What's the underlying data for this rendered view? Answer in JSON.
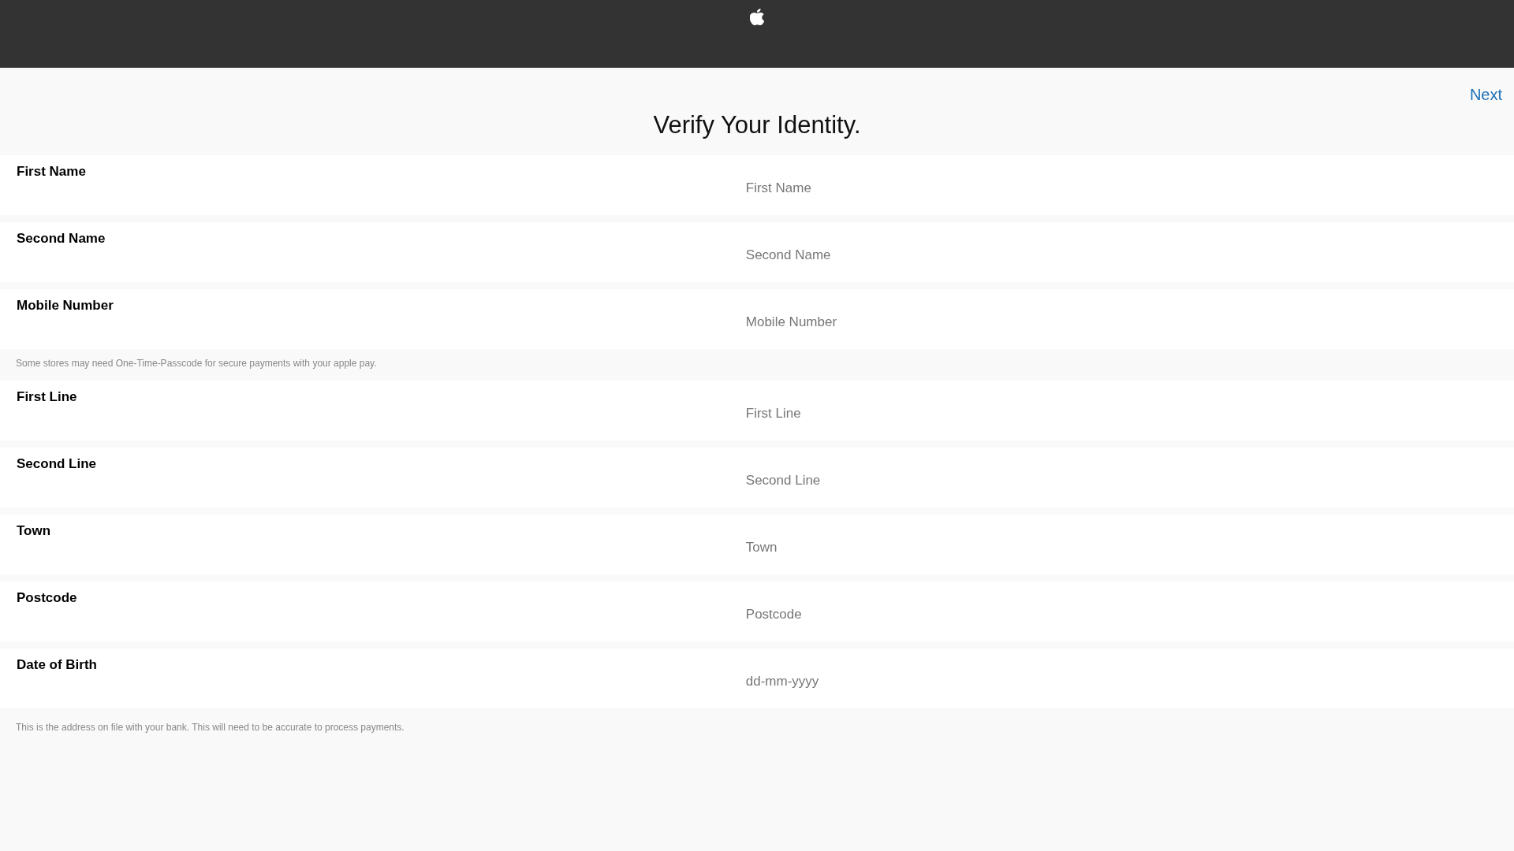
{
  "title": "Verify Your Identity.",
  "next_link": "Next",
  "sections": [
    {
      "fields": [
        {
          "label": "First Name",
          "placeholder": "First Name"
        },
        {
          "label": "Second Name",
          "placeholder": "Second Name"
        },
        {
          "label": "Mobile Number",
          "placeholder": "Mobile Number"
        }
      ],
      "note": "Some stores may need One-Time-Passcode for secure payments with your apple pay."
    },
    {
      "fields": [
        {
          "label": "First Line",
          "placeholder": "First Line"
        },
        {
          "label": "Second Line",
          "placeholder": "Second Line"
        },
        {
          "label": "Town",
          "placeholder": "Town"
        },
        {
          "label": "Postcode",
          "placeholder": "Postcode"
        },
        {
          "label": "Date of Birth",
          "placeholder": "dd-mm-yyyy"
        }
      ],
      "note": "This is the address on file with your bank. This will need to be accurate to process payments."
    }
  ]
}
